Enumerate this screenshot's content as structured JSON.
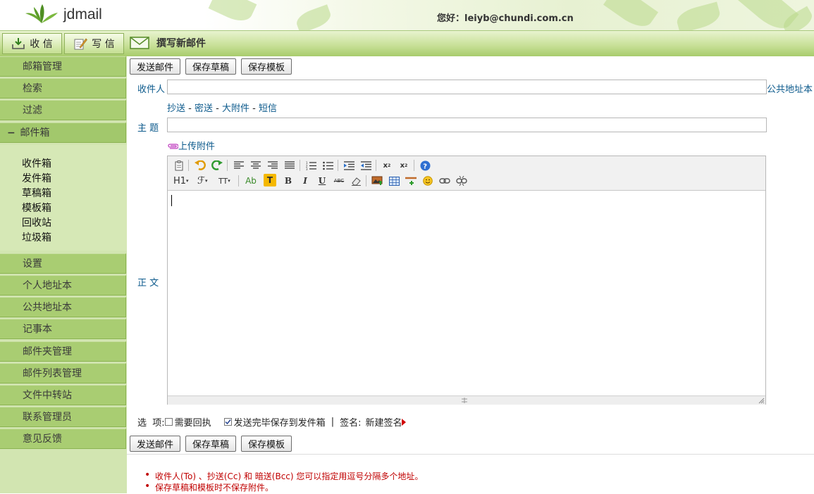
{
  "header": {
    "logo_text": "jdmail",
    "greeting": "您好：leiyb@chundi.com.cn"
  },
  "topbar": {
    "inbox_label": "收 信",
    "write_label": "写 信",
    "compose_title": "撰写新邮件"
  },
  "sidebar": {
    "items_top": [
      "邮箱管理",
      "检索",
      "过滤"
    ],
    "mailbox_label": "邮件箱",
    "mailbox_toggle": "−",
    "folders": [
      "收件箱",
      "发件箱",
      "草稿箱",
      "模板箱",
      "回收站",
      "垃圾箱"
    ],
    "items_bottom": [
      "设置",
      "个人地址本",
      "公共地址本",
      "记事本",
      "邮件夹管理",
      "邮件列表管理",
      "文件中转站",
      "联系管理员",
      "意见反馈"
    ]
  },
  "toolbar": {
    "send_label": "发送邮件",
    "save_draft_label": "保存草稿",
    "save_template_label": "保存模板"
  },
  "form": {
    "to_label": "收件人",
    "to_value": "",
    "public_addressbook_link": "公共地址本",
    "cc_link": "抄送",
    "bcc_link": "密送",
    "big_attachment_link": "大附件",
    "sms_link": "短信",
    "link_separator": " - ",
    "subject_label": "主 题",
    "subject_value": "",
    "upload_attachment_link": "上传附件",
    "body_label": "正 文",
    "body_value": ""
  },
  "editor_toolbar": {
    "row1": [
      "paste-icon",
      "undo-icon",
      "redo-icon",
      "align-left-icon",
      "align-center-icon",
      "align-right-icon",
      "justify-icon",
      "ordered-list-icon",
      "unordered-list-icon",
      "indent-icon",
      "outdent-icon",
      "subscript-icon",
      "superscript-icon",
      "help-icon"
    ],
    "heading_label": "H1",
    "font_label": "ℱ",
    "size_label": "TT",
    "font_color_label": "Ab",
    "highlight_label": "T",
    "bold_label": "B",
    "italic_label": "I",
    "underline_label": "U",
    "strike_label": "ABC"
  },
  "options": {
    "label": "选  项:",
    "read_receipt_label": "需要回执",
    "read_receipt_checked": false,
    "save_sent_label": "发送完毕保存到发件箱",
    "save_sent_checked": true,
    "divider": "|",
    "signature_label": "签名:",
    "signature_value": "新建签名"
  },
  "notes": [
    "收件人(To) 、抄送(Cc) 和 暗送(Bcc) 您可以指定用逗号分隔多个地址。",
    "保存草稿和模板时不保存附件。"
  ],
  "colors": {
    "sidebar_item": "#a9cd72",
    "sidebar_bg": "#d2e5b1",
    "label_blue": "#0c5a8c",
    "note_red": "#c00000"
  }
}
